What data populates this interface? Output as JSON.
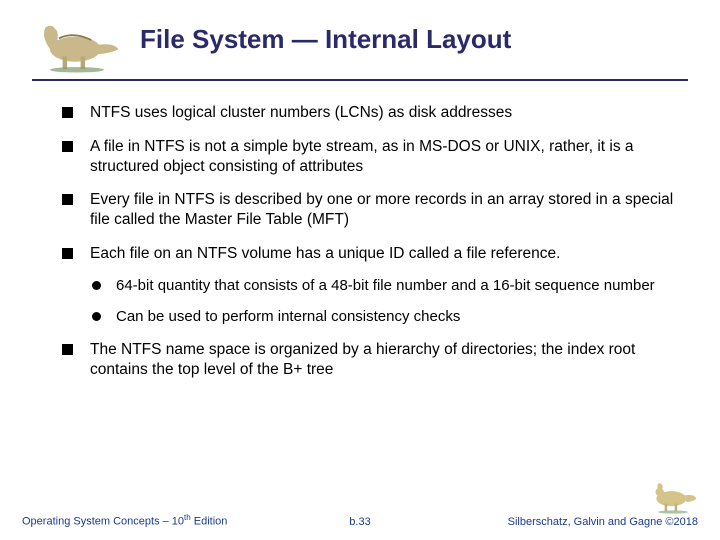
{
  "title": "File System — Internal Layout",
  "bullets": [
    {
      "text": "NTFS uses logical cluster numbers (LCNs) as disk addresses"
    },
    {
      "text": "A file in NTFS is not a simple byte stream, as in MS-DOS or UNIX, rather, it is a structured object consisting of attributes"
    },
    {
      "text": "Every file in NTFS is described by one or more records in an array stored in a special file called the Master File Table (MFT)"
    },
    {
      "text": "Each file on an NTFS volume has a unique ID called a file reference.",
      "sub": [
        "64-bit quantity that consists of a 48-bit file number and a 16-bit sequence number",
        "Can be used to perform internal consistency checks"
      ]
    },
    {
      "text": "The NTFS name space is organized by a hierarchy of directories; the index root contains the top level of the B+ tree"
    }
  ],
  "footer": {
    "left_prefix": "Operating System Concepts – 10",
    "left_sup": "th",
    "left_suffix": " Edition",
    "center": "b.33",
    "right": "Silberschatz, Galvin and Gagne ©2018"
  }
}
